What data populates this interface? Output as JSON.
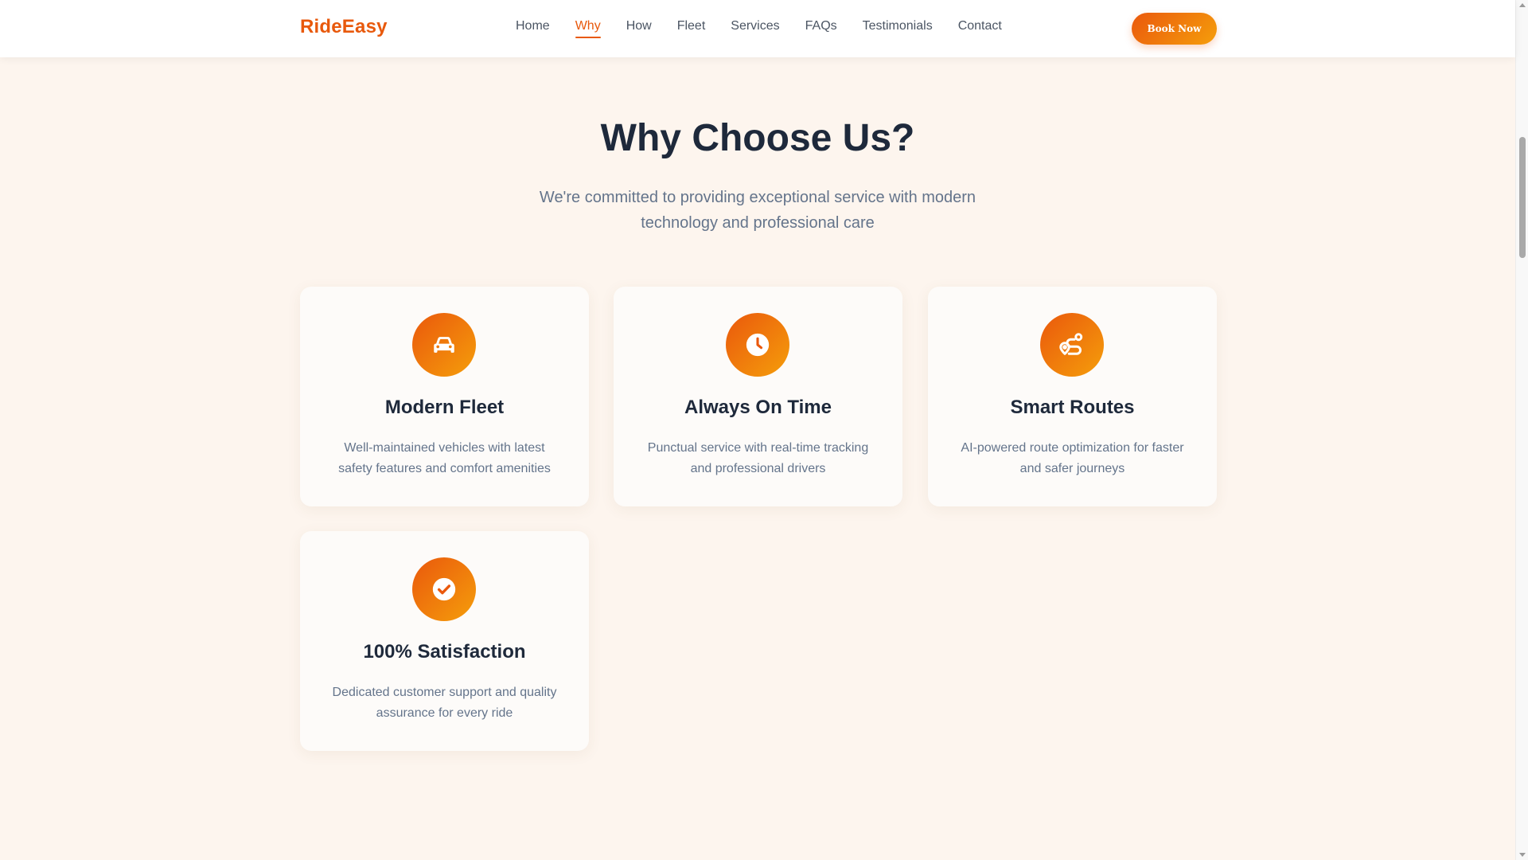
{
  "brand": {
    "name": "RideEasy",
    "color": "#e8590c"
  },
  "nav": {
    "items": [
      "Home",
      "Why",
      "How",
      "Fleet",
      "Services",
      "FAQs",
      "Testimonials",
      "Contact"
    ],
    "active": "Why"
  },
  "header": {
    "cta_label": "Book Now"
  },
  "section": {
    "title": "Why Choose Us?",
    "subtitle": "We're committed to providing exceptional service with modern technology and professional care"
  },
  "features": [
    {
      "icon": "car-icon",
      "title": "Modern Fleet",
      "description": "Well-maintained vehicles with latest safety features and comfort amenities"
    },
    {
      "icon": "clock-icon",
      "title": "Always On Time",
      "description": "Punctual service with real-time tracking and professional drivers"
    },
    {
      "icon": "route-icon",
      "title": "Smart Routes",
      "description": "AI-powered route optimization for faster and safer journeys"
    },
    {
      "icon": "check-circle-icon",
      "title": "100% Satisfaction",
      "description": "Dedicated customer support and quality assurance for every ride"
    }
  ],
  "colors": {
    "accent": "#ea580c",
    "accent_light": "#f59e0b",
    "background": "#fdf5ee",
    "heading": "#1e293b",
    "muted": "#64748b"
  }
}
